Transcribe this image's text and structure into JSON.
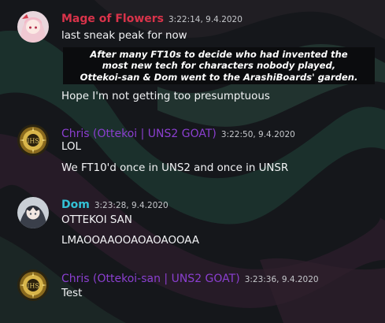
{
  "colors": {
    "mage_name": "#d9334a",
    "chris_name": "#8b3fd0",
    "dom_name": "#33c2d6",
    "message_text": "#f2f3f5",
    "timestamp": "#c5c7cb"
  },
  "messages": [
    {
      "author": "Mage of Flowers",
      "timestamp": "3:22:14, 9.4.2020",
      "avatar_icon": "anime-girl-avatar",
      "lines": [
        "last sneak peak for now"
      ],
      "embed_lines": [
        "After many FT10s to decide who had invented the",
        "most new tech for characters nobody played,",
        "Ottekoi-san & Dom went to the ArashiBoards' garden."
      ],
      "after_lines": [
        "Hope I'm not getting too presumptuous"
      ]
    },
    {
      "author": "Chris (Ottekoi | UNS2 GOAT)",
      "timestamp": "3:22:50, 9.4.2020",
      "avatar_icon": "ihs-emblem-avatar",
      "lines": [
        "LOL",
        "We FT10'd once in UNS2 and once in UNSR"
      ]
    },
    {
      "author": "Dom",
      "timestamp": "3:23:28, 9.4.2020",
      "avatar_icon": "dark-haired-character-avatar",
      "lines": [
        "OTTEKOI SAN",
        "LMAOOAAOOAOAOAOOAA"
      ]
    },
    {
      "author": "Chris (Ottekoi-san | UNS2 GOAT)",
      "timestamp": "3:23:36, 9.4.2020",
      "avatar_icon": "ihs-emblem-avatar",
      "lines": [
        "Test"
      ]
    }
  ]
}
